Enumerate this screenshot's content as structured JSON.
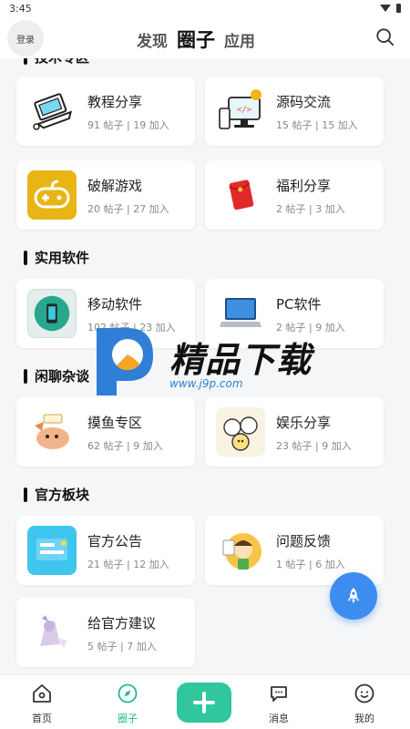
{
  "status_bar": {
    "time": "3:45"
  },
  "header": {
    "login_label": "登录",
    "tabs": [
      {
        "label": "发现",
        "active": false
      },
      {
        "label": "圈子",
        "active": true
      },
      {
        "label": "应用",
        "active": false
      }
    ]
  },
  "sections": [
    {
      "title": "技术专区",
      "cards": [
        {
          "name": "教程分享",
          "stats": "91 帖子 | 19 加入",
          "icon": "laptop-icon"
        },
        {
          "name": "源码交流",
          "stats": "15 帖子 | 15 加入",
          "icon": "computer-code-icon"
        },
        {
          "name": "破解游戏",
          "stats": "20 帖子 | 27 加入",
          "icon": "gamepad-icon"
        },
        {
          "name": "福利分享",
          "stats": "2 帖子 | 3 加入",
          "icon": "red-envelope-icon"
        }
      ]
    },
    {
      "title": "实用软件",
      "cards": [
        {
          "name": "移动软件",
          "stats": "102 帖子 | 23 加入",
          "icon": "phone-icon"
        },
        {
          "name": "PC软件",
          "stats": "2 帖子 | 9 加入",
          "icon": "pc-laptop-icon"
        }
      ]
    },
    {
      "title": "闲聊杂谈",
      "cards": [
        {
          "name": "摸鱼专区",
          "stats": "62 帖子 | 9 加入",
          "icon": "fish-cat-icon"
        },
        {
          "name": "娱乐分享",
          "stats": "23 帖子 | 9 加入",
          "icon": "cartoon-icon"
        }
      ]
    },
    {
      "title": "官方板块",
      "cards": [
        {
          "name": "官方公告",
          "stats": "21 帖子 | 12 加入",
          "icon": "notice-icon"
        },
        {
          "name": "问题反馈",
          "stats": "1 帖子 | 6 加入",
          "icon": "feedback-icon"
        },
        {
          "name": "给官方建议",
          "stats": "5 帖子 | 7 加入",
          "icon": "suggestion-icon"
        }
      ]
    }
  ],
  "watermark": {
    "text": "精品下载",
    "url": "www.j9p.com"
  },
  "bottom_nav": [
    {
      "label": "首页",
      "icon": "home-icon",
      "active": false
    },
    {
      "label": "圈子",
      "icon": "compass-icon",
      "active": true
    },
    {
      "label": "",
      "icon": "plus-icon",
      "active": false
    },
    {
      "label": "消息",
      "icon": "chat-icon",
      "active": false
    },
    {
      "label": "我的",
      "icon": "profile-icon",
      "active": false
    }
  ],
  "colors": {
    "accent_green": "#2fc79b",
    "fab_blue": "#3d8df0",
    "background": "#f5f6f8"
  }
}
